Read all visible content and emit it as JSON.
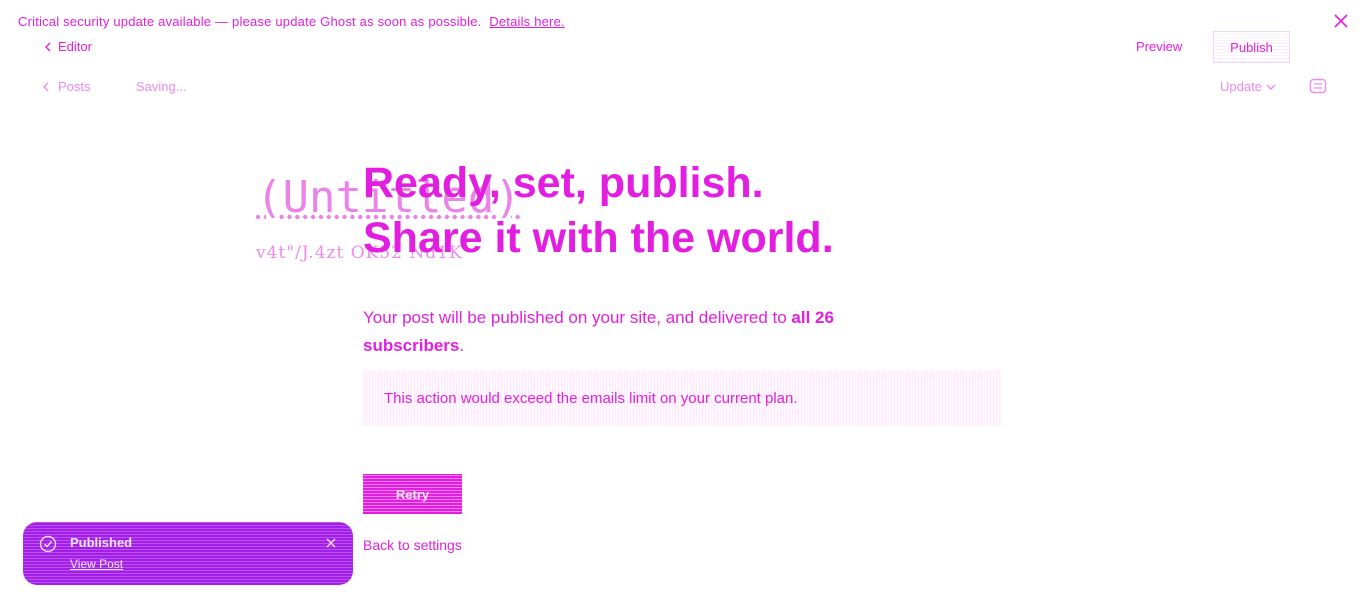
{
  "banner": {
    "message": "Critical security update available — please update Ghost as soon as possible.",
    "link_label": "Details here."
  },
  "publish_flow": {
    "back_label": "Editor",
    "preview_label": "Preview",
    "publish_label": "Publish"
  },
  "editor_header": {
    "posts_label": "Posts",
    "status": "Saving...",
    "update_label": "Update"
  },
  "editor_ghost": {
    "title": "(Untitled)",
    "subtitle": "v4t\"/J.4zt  OK52 Nd1K"
  },
  "main": {
    "headline_line1": "Ready, set, publish.",
    "headline_line2": "Share it with the world.",
    "desc_prefix": "Your post will be published on your site, and delivered to ",
    "desc_bold": "all 26 subscribers",
    "desc_suffix": ".",
    "error_message": "This action would exceed the emails limit on your current plan.",
    "retry_label": "Retry",
    "back_label": "Back to settings"
  },
  "toast": {
    "title": "Published",
    "link_label": "View Post"
  },
  "colors": {
    "accent": "#e21fe0",
    "toast_bg": "#a020e8"
  }
}
